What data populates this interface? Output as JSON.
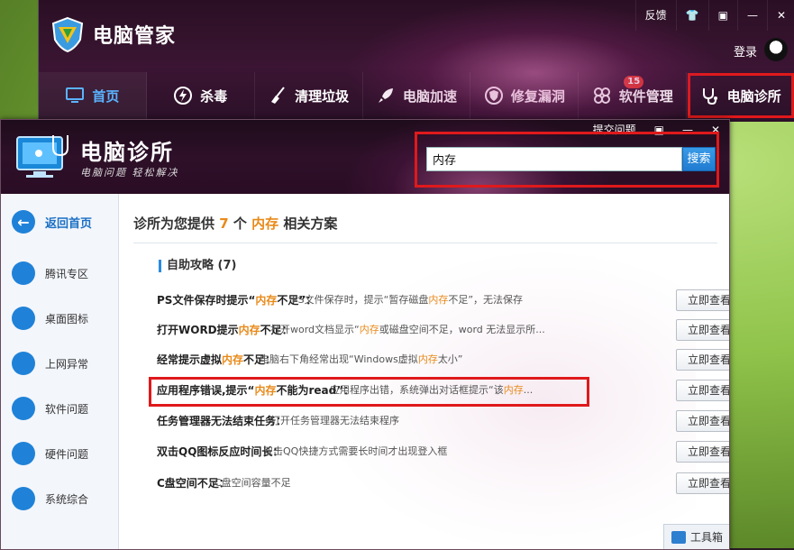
{
  "main_window": {
    "title": "电脑管家",
    "controls": [
      "反馈",
      "👕",
      "▣",
      "—",
      "✕"
    ],
    "login": "登录",
    "nav": [
      {
        "label": "首页",
        "icon": "monitor-icon"
      },
      {
        "label": "杀毒",
        "icon": "lightning-icon"
      },
      {
        "label": "清理垃圾",
        "icon": "broom-icon"
      },
      {
        "label": "电脑加速",
        "icon": "rocket-icon"
      },
      {
        "label": "修复漏洞",
        "icon": "shield-icon"
      },
      {
        "label": "软件管理",
        "icon": "apps-icon",
        "badge": "15"
      },
      {
        "label": "电脑诊所",
        "icon": "stethoscope-icon"
      }
    ]
  },
  "clinic": {
    "title": "电脑诊所",
    "subtitle": "电脑问题 轻松解决",
    "controls": [
      "提交问题",
      "▣",
      "—",
      "✕"
    ],
    "search": {
      "value": "内存",
      "button": "搜索"
    },
    "sidebar": [
      {
        "label": "返回首页"
      },
      {
        "label": "腾讯专区"
      },
      {
        "label": "桌面图标"
      },
      {
        "label": "上网异常"
      },
      {
        "label": "软件问题"
      },
      {
        "label": "硬件问题"
      },
      {
        "label": "系统综合"
      }
    ],
    "summary": {
      "prefix": "诊所为您提供",
      "count": "7",
      "unit": "个",
      "keyword": "内存",
      "suffix": "相关方案"
    },
    "section": "自助攻略 (7)",
    "view_label": "立即查看",
    "results": [
      {
        "t1": "PS文件保存时提示“",
        "t2": "内存",
        "t3": "不足”：",
        "d1": "PS文件保存时，提示“暂存磁盘",
        "d2": "内存",
        "d3": "不足”，无法保存"
      },
      {
        "t1": "打开WORD提示",
        "t2": "内存",
        "t3": "不足：",
        "d1": "打开word文档显示“",
        "d2": "内存",
        "d3": "或磁盘空间不足，word 无法显示所..."
      },
      {
        "t1": "经常提示虚拟",
        "t2": "内存",
        "t3": "不足：",
        "d1": "电脑右下角经常出现“Windows虚拟",
        "d2": "内存",
        "d3": "太小”"
      },
      {
        "t1": "应用程序错误,提示“",
        "t2": "内存",
        "t3": "不能为read”：",
        "d1": "应用程序出错，系统弹出对话框提示“该",
        "d2": "内存",
        "d3": "..."
      },
      {
        "t1": "任务管理器无法结束任务：",
        "t2": "",
        "t3": "",
        "d1": "打开任务管理器无法结束程序",
        "d2": "",
        "d3": ""
      },
      {
        "t1": "双击QQ图标反应时间长：",
        "t2": "",
        "t3": "",
        "d1": "双击QQ快捷方式需要长时间才出现登入框",
        "d2": "",
        "d3": ""
      },
      {
        "t1": "C盘空间不足：",
        "t2": "",
        "t3": "",
        "d1": "C盘空间容量不足",
        "d2": "",
        "d3": ""
      }
    ],
    "toolbox": "工具箱"
  },
  "colors": {
    "accent": "#1f82d8",
    "highlight": "#e88a1a",
    "annotation": "#e0191b"
  }
}
